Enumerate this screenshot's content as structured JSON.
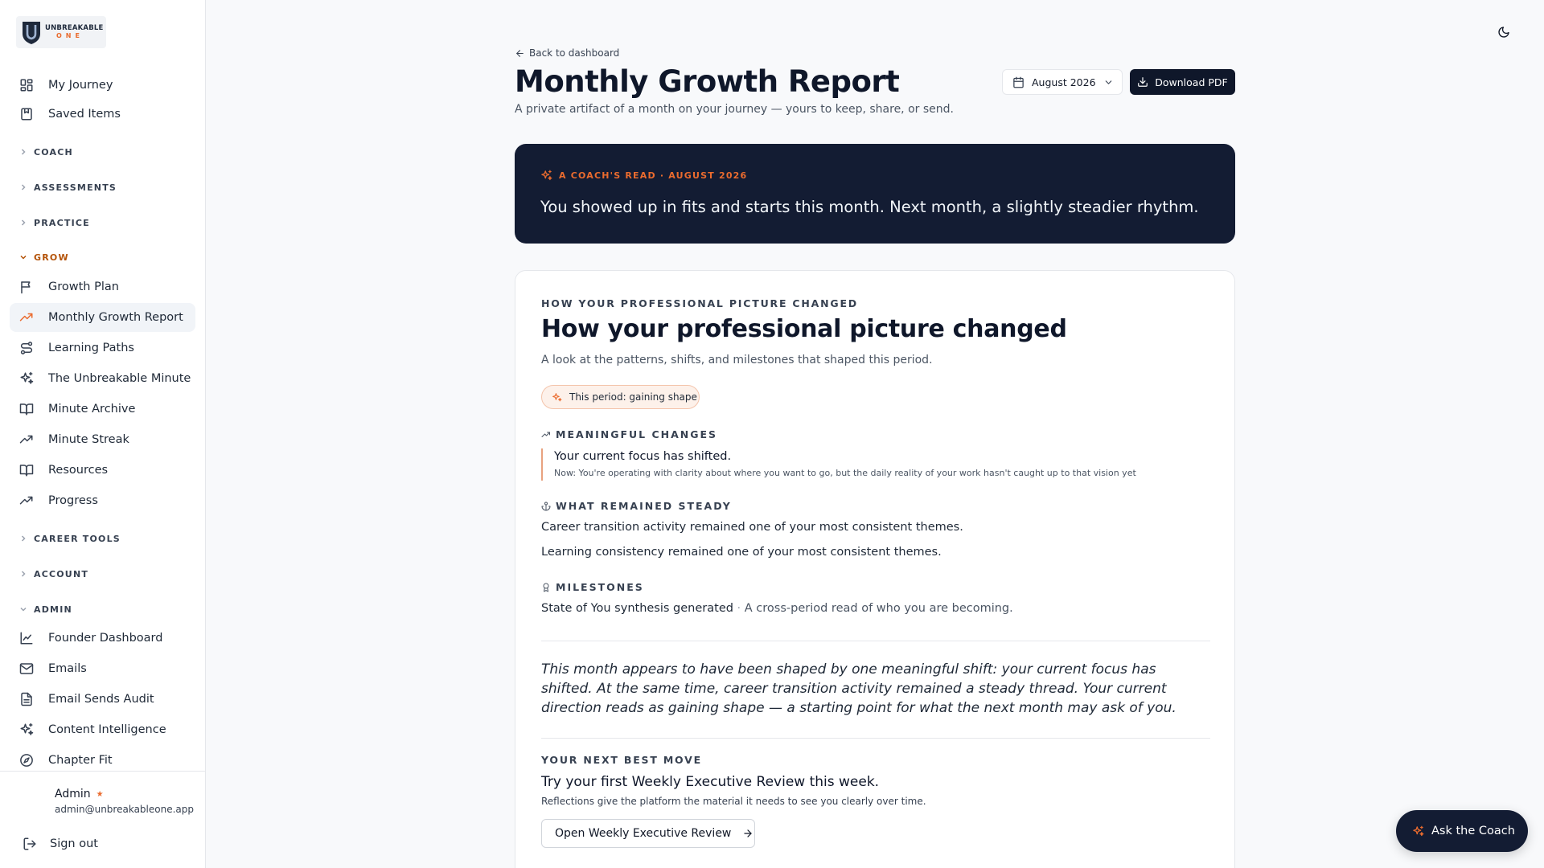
{
  "brand": {
    "logo_line1": "UNBREAKABLE",
    "logo_line2": "ONE",
    "accent": "#ea6b2e",
    "navy": "#131c33"
  },
  "sidebar": {
    "top_items": [
      {
        "label": "My Journey",
        "icon": "grid-icon"
      },
      {
        "label": "Saved Items",
        "icon": "bookmark-icon"
      }
    ],
    "sections": {
      "coach": "COACH",
      "assessments": "ASSESSMENTS",
      "practice": "PRACTICE",
      "grow": "GROW",
      "career_tools": "CAREER TOOLS",
      "account": "ACCOUNT",
      "admin": "ADMIN"
    },
    "grow_items": [
      {
        "label": "Growth Plan",
        "icon": "flag-icon"
      },
      {
        "label": "Monthly Growth Report",
        "icon": "trending-up-icon",
        "active": true
      },
      {
        "label": "Learning Paths",
        "icon": "route-icon"
      },
      {
        "label": "The Unbreakable Minute",
        "icon": "sparkles-icon"
      },
      {
        "label": "Minute Archive",
        "icon": "book-open-icon"
      },
      {
        "label": "Minute Streak",
        "icon": "trending-up-icon"
      },
      {
        "label": "Resources",
        "icon": "book-open-icon"
      },
      {
        "label": "Progress",
        "icon": "trending-up-icon"
      }
    ],
    "admin_items": [
      {
        "label": "Founder Dashboard",
        "icon": "line-chart-icon"
      },
      {
        "label": "Emails",
        "icon": "mail-icon"
      },
      {
        "label": "Email Sends Audit",
        "icon": "file-text-icon"
      },
      {
        "label": "Content Intelligence",
        "icon": "sparkles-icon"
      },
      {
        "label": "Chapter Fit",
        "icon": "compass-icon"
      }
    ],
    "user": {
      "name": "Admin",
      "email": "admin@unbreakableone.app"
    },
    "sign_out": "Sign out"
  },
  "header": {
    "back_link": "Back to dashboard",
    "title": "Monthly Growth Report",
    "subtitle": "A private artifact of a month on your journey — yours to keep, share, or send.",
    "month_selected": "August 2026",
    "download_label": "Download PDF"
  },
  "coach_read": {
    "eyebrow": "A COACH'S READ · AUGUST 2026",
    "text": "You showed up in fits and starts this month. Next month, a slightly steadier rhythm."
  },
  "report": {
    "eyebrow": "HOW YOUR PROFESSIONAL PICTURE CHANGED",
    "title": "How your professional picture changed",
    "subtitle": "A look at the patterns, shifts, and milestones that shaped this period.",
    "period_badge": "This period: gaining shape",
    "meaningful_changes": {
      "heading": "MEANINGFUL CHANGES",
      "items": [
        {
          "title": "Your current focus has shifted.",
          "detail": "Now: You're operating with clarity about where you want to go, but the daily reality of your work hasn't caught up to that vision yet"
        }
      ]
    },
    "steady": {
      "heading": "WHAT REMAINED STEADY",
      "items": [
        "Career transition activity remained one of your most consistent themes.",
        "Learning consistency remained one of your most consistent themes."
      ]
    },
    "milestones": {
      "heading": "MILESTONES",
      "items": [
        {
          "title": "State of You synthesis generated",
          "separator": " · ",
          "description": "A cross-period read of who you are becoming."
        }
      ]
    },
    "summary": "This month appears to have been shaped by one meaningful shift: your current focus has shifted. At the same time, career transition activity remained a steady thread. Your current direction reads as gaining shape — a starting point for what the next month may ask of you.",
    "next_move": {
      "eyebrow": "YOUR NEXT BEST MOVE",
      "title": "Try your first Weekly Executive Review this week.",
      "note": "Reflections give the platform the material it needs to see you clearly over time.",
      "button": "Open Weekly Executive Review"
    }
  },
  "ask_coach": "Ask the Coach"
}
